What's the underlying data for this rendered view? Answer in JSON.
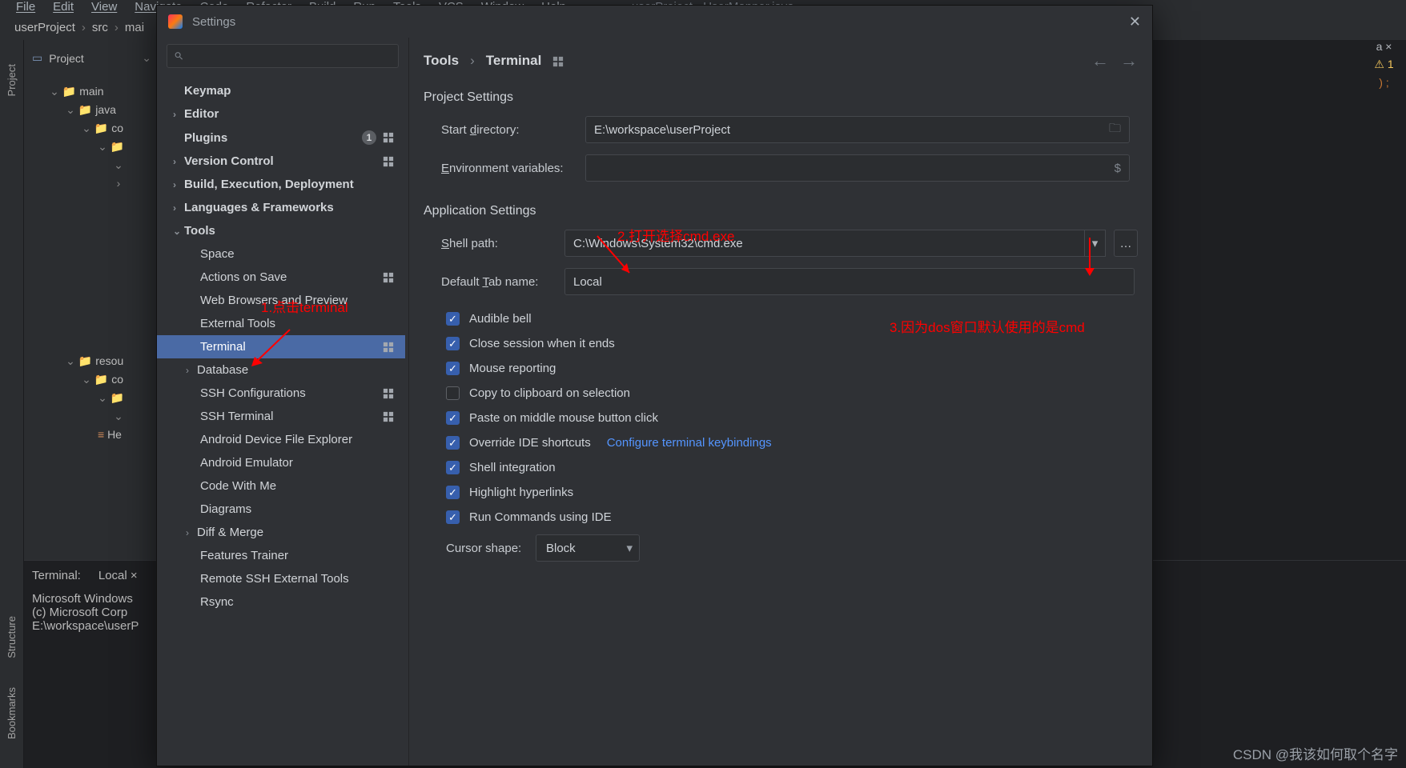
{
  "menubar": [
    "File",
    "Edit",
    "View",
    "Navigate",
    "Code",
    "Refactor",
    "Build",
    "Run",
    "Tools",
    "VCS",
    "Window",
    "Help"
  ],
  "windowDoc": "userProject - UserMapper.java",
  "breadcrumb": [
    "userProject",
    "src",
    "mai"
  ],
  "projectPanel": {
    "title": "Project",
    "tree": {
      "main": "main",
      "java": "java",
      "co": "co",
      "resources": "resou",
      "co2": "co",
      "he": "He"
    }
  },
  "vertTabs": {
    "project": "Project",
    "structure": "Structure",
    "bookmarks": "Bookmarks"
  },
  "terminal": {
    "label": "Terminal:",
    "tab": "Local",
    "lines": [
      "Microsoft Windows",
      "(c) Microsoft Corp",
      "",
      "E:\\workspace\\userP"
    ]
  },
  "rightGutter": {
    "closeTab": "a ×",
    "warn": "⚠ 1",
    "codeTail": ") ;"
  },
  "dialog": {
    "title": "Settings",
    "searchPlaceholder": "",
    "nav": {
      "keymap": "Keymap",
      "editor": "Editor",
      "plugins": "Plugins",
      "pluginsCount": "1",
      "versionControl": "Version Control",
      "bed": "Build, Execution, Deployment",
      "lang": "Languages & Frameworks",
      "tools": "Tools",
      "children": {
        "space": "Space",
        "actionsOnSave": "Actions on Save",
        "webBrowsers": "Web Browsers and Preview",
        "externalTools": "External Tools",
        "terminal": "Terminal",
        "database": "Database",
        "sshConfig": "SSH Configurations",
        "sshTerm": "SSH Terminal",
        "adfe": "Android Device File Explorer",
        "emu": "Android Emulator",
        "cwm": "Code With Me",
        "diagrams": "Diagrams",
        "diffMerge": "Diff & Merge",
        "ft": "Features Trainer",
        "rssh": "Remote SSH External Tools",
        "rsync": "Rsync"
      }
    },
    "crumb": {
      "tools": "Tools",
      "terminal": "Terminal"
    },
    "sections": {
      "project": "Project Settings",
      "app": "Application Settings"
    },
    "labels": {
      "startDir": "Start directory:",
      "startDirU": "d",
      "envVars": "Environment variables:",
      "envVarsU": "E",
      "shellPath": "Shell path:",
      "shellPathU": "S",
      "tabName": "Default Tab name:",
      "tabNameU": "T",
      "cursor": "Cursor shape:"
    },
    "values": {
      "startDir": "E:\\workspace\\userProject",
      "envVars": "",
      "shellPath": "C:\\Windows\\System32\\cmd.exe",
      "tabName": "Local",
      "cursor": "Block"
    },
    "checks": {
      "audible": {
        "label": "Audible bell",
        "on": true
      },
      "close": {
        "label": "Close session when it ends",
        "on": true
      },
      "mouse": {
        "label": "Mouse reporting",
        "on": true
      },
      "copy": {
        "label": "Copy to clipboard on selection",
        "on": false
      },
      "paste": {
        "label": "Paste on middle mouse button click",
        "on": true
      },
      "override": {
        "label": "Override IDE shortcuts",
        "on": true
      },
      "shell": {
        "label": "Shell integration",
        "on": true
      },
      "hl": {
        "label": "Highlight hyperlinks",
        "on": true
      },
      "ide": {
        "label": "Run Commands using IDE",
        "on": true
      }
    },
    "link": "Configure terminal keybindings"
  },
  "annotations": {
    "a1": "1.点击terminal",
    "a2": "2.打开选择cmd.exe",
    "a3": "3.因为dos窗口默认使用的是cmd"
  },
  "watermark": "CSDN @我该如何取个名字"
}
